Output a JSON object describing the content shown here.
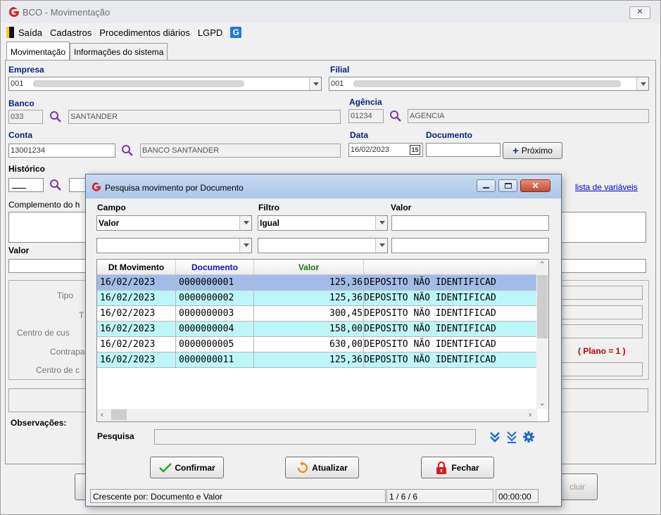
{
  "window": {
    "title": "BCO - Movimentação"
  },
  "menu": {
    "items": [
      "Saída",
      "Cadastros",
      "Procedimentos diários",
      "LGPD"
    ],
    "badge": "G"
  },
  "tabs": [
    "Movimentação",
    "Informações do sistema"
  ],
  "form": {
    "empresa_label": "Empresa",
    "empresa_value": "001",
    "filial_label": "Filial",
    "filial_value": "001",
    "banco_label": "Banco",
    "banco_code": "033",
    "banco_name": "SANTANDER",
    "agencia_label": "Agência",
    "agencia_code": "01234",
    "agencia_name": "AGENCIA",
    "conta_label": "Conta",
    "conta_code": "13001234",
    "conta_name": "BANCO SANTANDER",
    "data_label": "Data",
    "data_value": "16/02/2023",
    "calendar_badge": "15",
    "documento_label": "Documento",
    "documento_value": "",
    "proximo_label": "Próximo",
    "historico_label": "Histórico",
    "lista_variaveis": "lista de variáveis",
    "complemento_label": "Complemento do h",
    "valor_label": "Valor",
    "tipo_label": "Tipo",
    "t_label": "T",
    "centro_custo_label": "Centro de cus",
    "contrapartida_label": "Contrapa",
    "centro_c_label": "Centro de c",
    "plano_label": "( Plano = 1 )",
    "observacoes_label": "Observações:",
    "excluir_label": "cluir"
  },
  "dialog": {
    "title": "Pesquisa movimento por Documento",
    "campo_label": "Campo",
    "filtro_label": "Filtro",
    "valor_label": "Valor",
    "campo1": "Valor",
    "filtro1": "Igual",
    "valor1": "",
    "campo2": "",
    "filtro2": "",
    "valor2": "",
    "columns": [
      "Dt Movimento",
      "Documento",
      "Valor"
    ],
    "column_colors": [
      "#000000",
      "#1010c8",
      "#0a7a0a"
    ],
    "rows": [
      {
        "data": "16/02/2023",
        "doc": "0000000001",
        "valor": "125,36",
        "hist": "DEPOSITO NÃO IDENTIFICAD",
        "style": "selected"
      },
      {
        "data": "16/02/2023",
        "doc": "0000000002",
        "valor": "125,36",
        "hist": "DEPOSITO NÃO IDENTIFICAD",
        "style": "cyan"
      },
      {
        "data": "16/02/2023",
        "doc": "0000000003",
        "valor": "300,45",
        "hist": "DEPOSITO NÃO IDENTIFICAD",
        "style": "white"
      },
      {
        "data": "16/02/2023",
        "doc": "0000000004",
        "valor": "158,00",
        "hist": "DEPOSITO NÃO IDENTIFICAD",
        "style": "cyan"
      },
      {
        "data": "16/02/2023",
        "doc": "0000000005",
        "valor": "630,00",
        "hist": "DEPOSITO NÃO IDENTIFICAD",
        "style": "white"
      },
      {
        "data": "16/02/2023",
        "doc": "0000000011",
        "valor": "125,36",
        "hist": "DEPOSITO NÃO IDENTIFICAD",
        "style": "cyan"
      }
    ],
    "row_colors": {
      "selected": "#a2bcea",
      "cyan": "#bdf6f8",
      "white": "#ffffff"
    },
    "pesquisa_label": "Pesquisa",
    "pesquisa_value": "",
    "confirmar_label": "Confirmar",
    "atualizar_label": "Atualizar",
    "fechar_label": "Fechar",
    "status_order": "Crescente por: Documento e Valor",
    "status_count": "1 / 6 / 6",
    "status_time": "00:00:00"
  }
}
